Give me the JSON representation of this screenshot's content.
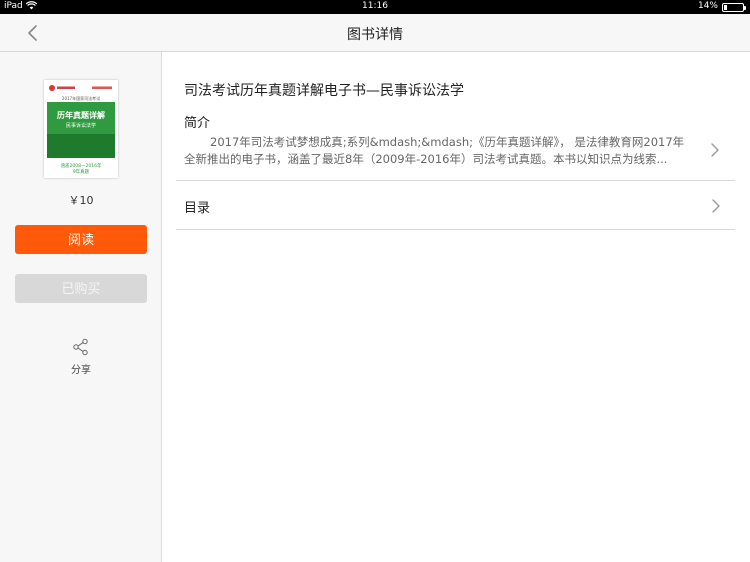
{
  "status_bar": {
    "device": "iPad",
    "time": "11:16",
    "battery_percent_text": "14%",
    "battery_level": 0.14
  },
  "nav": {
    "title": "图书详情",
    "back_icon": "chevron-left-icon"
  },
  "sidebar": {
    "cover": {
      "series_line": "2017年国家司法考试",
      "title": "历年真题详解",
      "subtitle": "民事诉讼法学",
      "range_line1": "涵盖2008—2016年",
      "range_line2": "9年真题"
    },
    "price": "￥10",
    "read_button": "阅读",
    "bought_button": "已购买",
    "share_label": "分享",
    "share_icon": "share-icon"
  },
  "book": {
    "title": "司法考试历年真题详解电子书—民事诉讼法学",
    "intro_label": "简介",
    "intro_line1": "2017年司法考试梦想成真;系列&mdash;&mdash;《历年真题详解》， 是法律教育网2017年",
    "intro_line2": "全新推出的电子书，涵盖了最近8年（2009年-2016年）司法考试真题。本书以知识点为线索...",
    "toc_label": "目录"
  },
  "colors": {
    "accent": "#ff5a0a",
    "disabled": "#d8d8d8",
    "cover_green": "#2f9a3f"
  }
}
